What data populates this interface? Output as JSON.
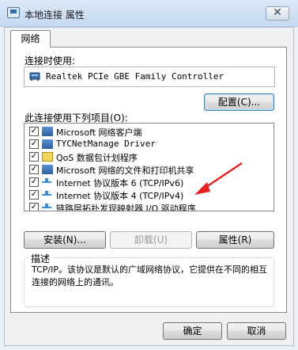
{
  "window": {
    "title": "本地连接 属性",
    "close_label": "✕"
  },
  "tabs": [
    {
      "label": "网络"
    }
  ],
  "connect_using_label": "连接时使用:",
  "adapter_name": "Realtek PCIe GBE Family Controller",
  "configure_label": "配置(C)...",
  "items_label": "此连接使用下列项目(O):",
  "items": [
    {
      "label": "Microsoft 网络客户端",
      "checked": true,
      "icon": "network-client-icon"
    },
    {
      "label": "TYCNetManage Driver",
      "checked": true,
      "icon": "driver-icon"
    },
    {
      "label": "QoS 数据包计划程序",
      "checked": true,
      "icon": "qos-scheduler-icon"
    },
    {
      "label": "Microsoft 网络的文件和打印机共享",
      "checked": true,
      "icon": "file-share-icon"
    },
    {
      "label": "Internet 协议版本 6 (TCP/IPv6)",
      "checked": true,
      "icon": "protocol-icon"
    },
    {
      "label": "Internet 协议版本 4 (TCP/IPv4)",
      "checked": true,
      "icon": "protocol-icon"
    },
    {
      "label": "链路层拓扑发现映射器 I/O 驱动程序",
      "checked": true,
      "icon": "protocol-icon"
    }
  ],
  "buttons": {
    "install": "安装(N)...",
    "uninstall": "卸载(U)",
    "properties": "属性(R)",
    "ok": "确定",
    "cancel": "取消"
  },
  "description": {
    "title": "描述",
    "text": "TCP/IP。该协议是默认的广域网络协议，它提供在不同的相互连接的网络上的通讯。"
  },
  "colors": {
    "annotation_arrow": "#e32222",
    "list_border": "#828790"
  }
}
